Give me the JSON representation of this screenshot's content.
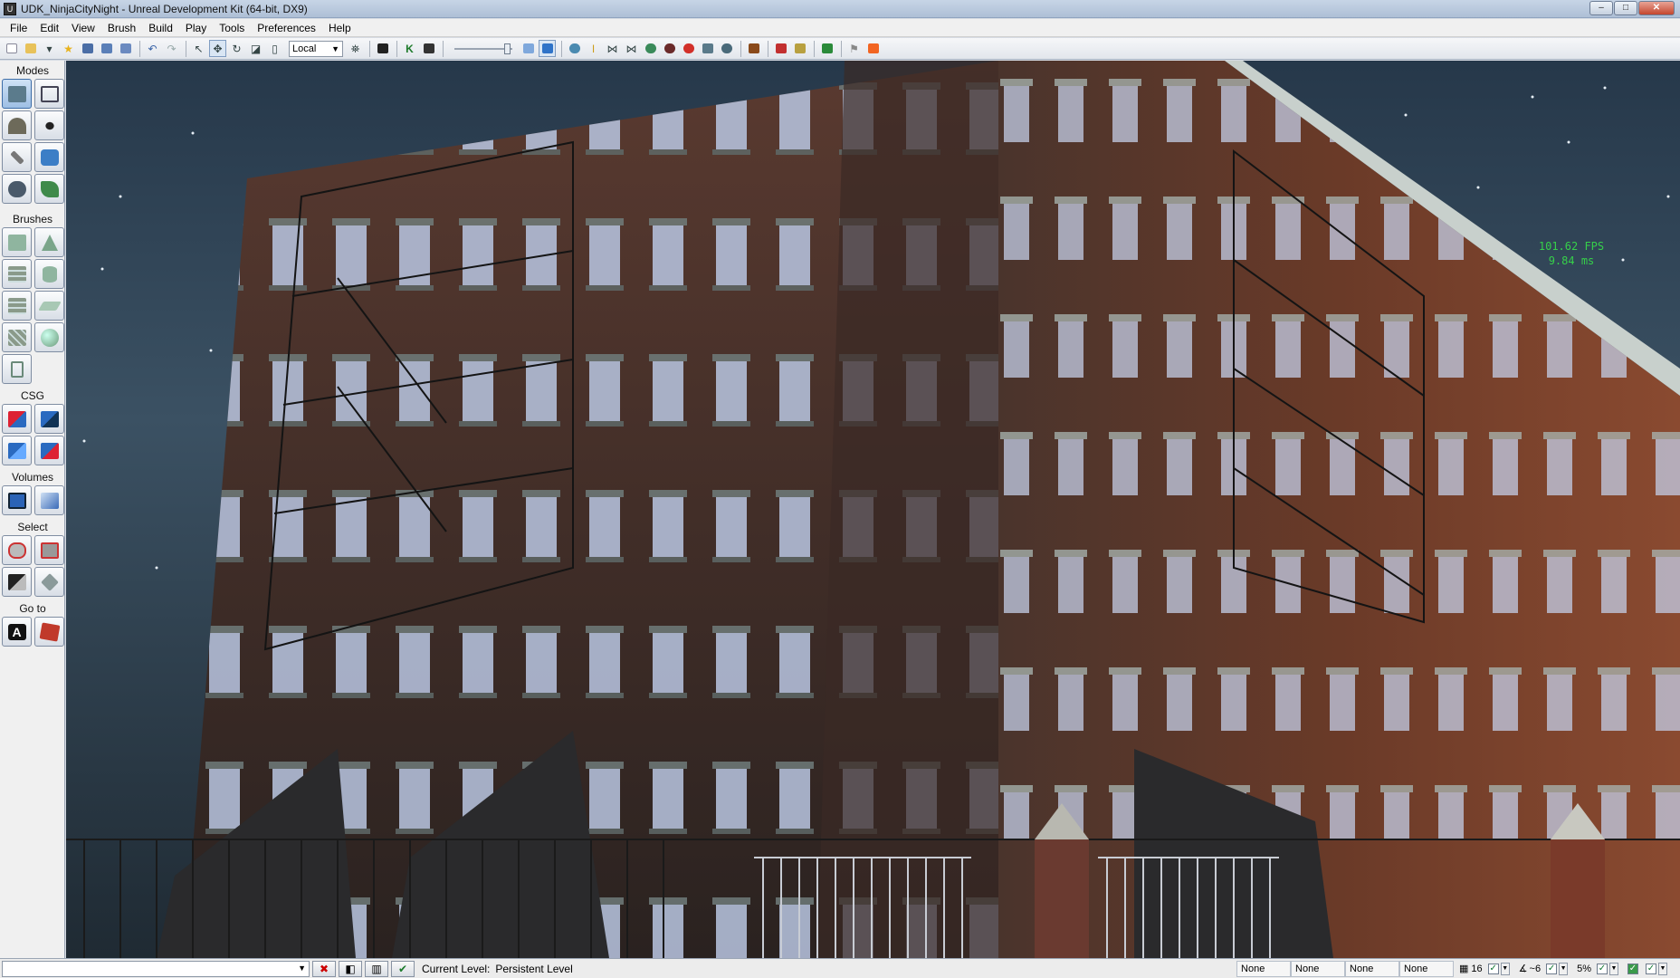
{
  "window": {
    "title": "UDK_NinjaCityNight - Unreal Development Kit (64-bit, DX9)",
    "controls": [
      "–",
      "□",
      "✕"
    ]
  },
  "menu": [
    "File",
    "Edit",
    "View",
    "Brush",
    "Build",
    "Play",
    "Tools",
    "Preferences",
    "Help"
  ],
  "toolbar": {
    "coordinate_system": "Local"
  },
  "modes_panel": {
    "sections": [
      {
        "label": "Modes",
        "buttons": [
          "camera-mode-icon",
          "geometry-mode-icon",
          "terrain-mode-icon",
          "static-mesh-mode-icon",
          "texture-align-icon",
          "mesh-paint-icon",
          "landscape-icon",
          "foliage-icon"
        ]
      },
      {
        "label": "Brushes",
        "buttons": [
          "cube-brush-icon",
          "cone-brush-icon",
          "curved-stair-icon",
          "cylinder-brush-icon",
          "linear-stair-icon",
          "sheet-brush-icon",
          "spiral-stair-icon",
          "sphere-brush-icon",
          "volumetric-brush-icon"
        ]
      },
      {
        "label": "CSG",
        "buttons": [
          "csg-add-icon",
          "csg-subtract-icon",
          "csg-intersect-icon",
          "csg-deintersect-icon"
        ]
      },
      {
        "label": "Volumes",
        "buttons": [
          "add-volume-icon",
          "volume-list-icon"
        ]
      },
      {
        "label": "Select",
        "buttons": [
          "show-selected-icon",
          "hide-selected-icon",
          "select-inverse-icon",
          "show-all-icon"
        ]
      },
      {
        "label": "Go to",
        "buttons": [
          "go-to-actor-icon",
          "go-to-builder-brush-icon"
        ]
      }
    ]
  },
  "viewport": {
    "fps": "101.62 FPS",
    "frame_time": "9.84 ms"
  },
  "statusbar": {
    "current_level_label": "Current Level:",
    "current_level": "Persistent Level",
    "fields": [
      "None",
      "None",
      "None",
      "None"
    ],
    "grid_size": "16",
    "rotation_snap": "~6",
    "scale_snap": "5%"
  }
}
